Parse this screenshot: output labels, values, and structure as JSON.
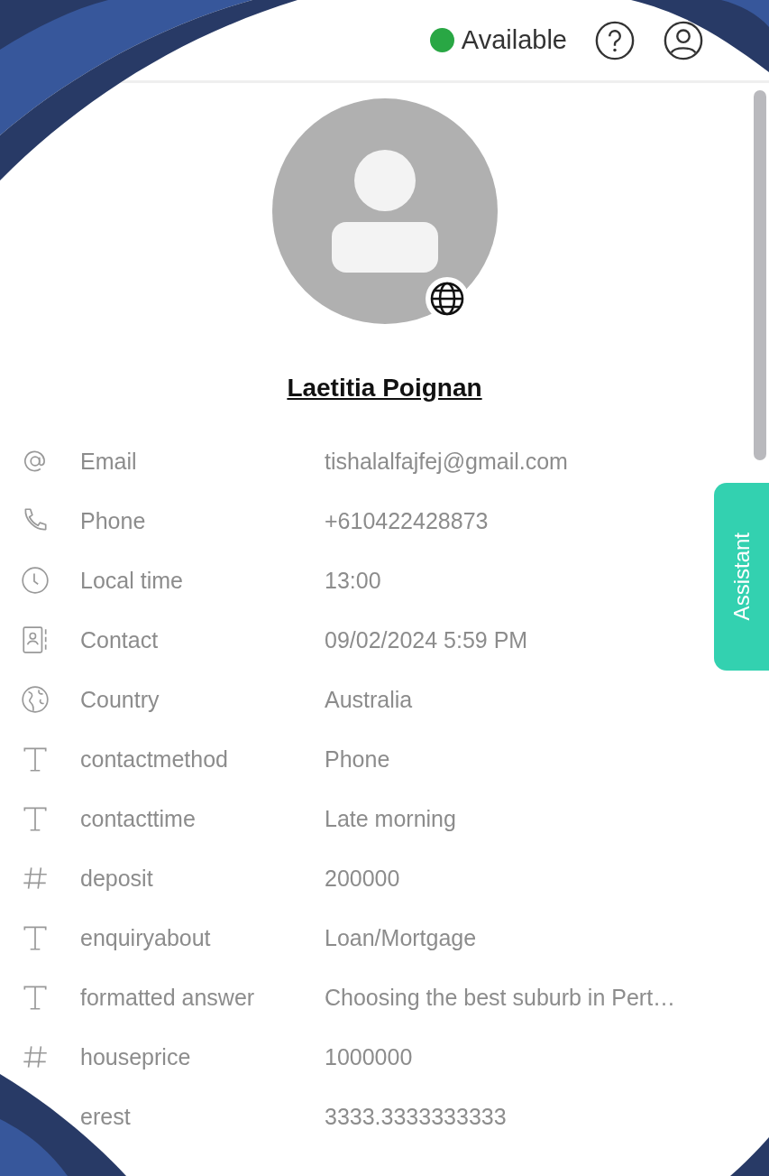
{
  "header": {
    "status": {
      "label": "Available",
      "color": "#29a744"
    }
  },
  "profile": {
    "name": "Laetitia Poignan"
  },
  "fields": [
    {
      "kind": "email",
      "label": "Email",
      "value": "tishalalfajfej@gmail.com"
    },
    {
      "kind": "phone",
      "label": "Phone",
      "value": "+610422428873"
    },
    {
      "kind": "clock",
      "label": "Local time",
      "value": "13:00"
    },
    {
      "kind": "contact",
      "label": "Contact",
      "value": "09/02/2024 5:59 PM"
    },
    {
      "kind": "globe",
      "label": "Country",
      "value": "Australia"
    },
    {
      "kind": "text",
      "label": "contactmethod",
      "value": "Phone"
    },
    {
      "kind": "text",
      "label": "contacttime",
      "value": "Late morning"
    },
    {
      "kind": "number",
      "label": "deposit",
      "value": "200000"
    },
    {
      "kind": "text",
      "label": "enquiryabout",
      "value": "Loan/Mortgage"
    },
    {
      "kind": "text",
      "label": "formatted answer",
      "value": "Choosing the best suburb in Pert…"
    },
    {
      "kind": "number",
      "label": "houseprice",
      "value": "1000000"
    },
    {
      "kind": "none",
      "label": "erest",
      "value": "3333.3333333333"
    }
  ],
  "assistant_tab": {
    "label": "Assistant"
  }
}
